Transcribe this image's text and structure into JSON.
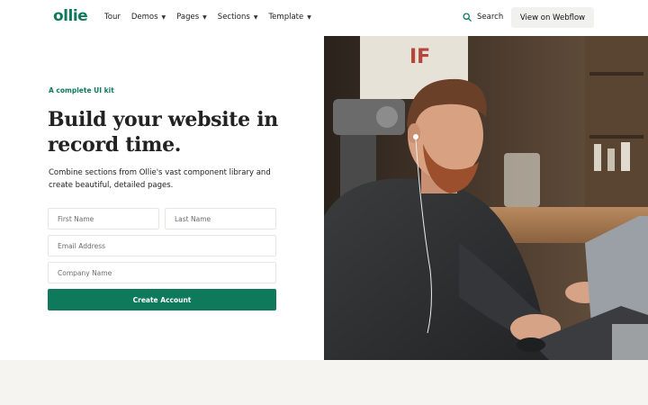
{
  "nav": {
    "logo": "ollie",
    "menu": [
      {
        "label": "Tour",
        "has_dropdown": false
      },
      {
        "label": "Demos",
        "has_dropdown": true
      },
      {
        "label": "Pages",
        "has_dropdown": true
      },
      {
        "label": "Sections",
        "has_dropdown": true
      },
      {
        "label": "Template",
        "has_dropdown": true
      }
    ],
    "search_label": "Search",
    "search_icon": "search-icon",
    "cta_label": "View on Webflow"
  },
  "hero": {
    "kicker": "A complete UI kit",
    "headline": "Build your website in record time.",
    "subtext": "Combine sections from Ollie's vast component library and create beautiful, detailed pages.",
    "form": {
      "first_name_placeholder": "First Name",
      "last_name_placeholder": "Last Name",
      "email_placeholder": "Email Address",
      "company_placeholder": "Company Name",
      "submit_label": "Create Account"
    },
    "photo_sign_text": "IF"
  },
  "colors": {
    "brand": "#0f7a5b",
    "background": "#f5f4f1",
    "surface": "#ffffff"
  }
}
